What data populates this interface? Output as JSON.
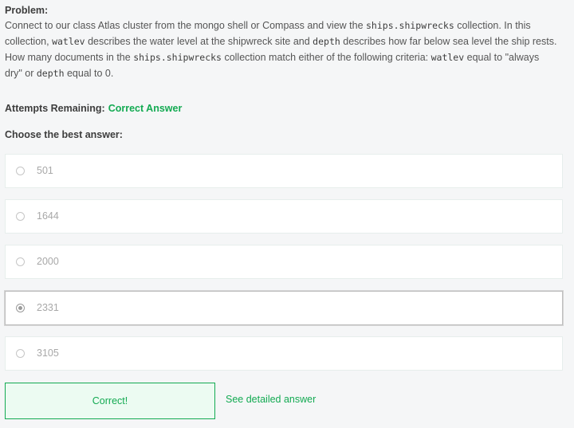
{
  "problem": {
    "title": "Problem:",
    "line1_a": "Connect to our class Atlas cluster from the mongo shell or Compass and view the ",
    "line1_code": "ships.shipwrecks",
    "line1_b": " collection. In this",
    "line2_a": "collection, ",
    "line2_code1": "watlev",
    "line2_b": " describes the water level at the shipwreck site and ",
    "line2_code2": "depth",
    "line2_c": " describes how far below sea level the ship rests.",
    "line3_a": "How many documents in the ",
    "line3_code1": "ships.shipwrecks",
    "line3_b": " collection match either of the following criteria: ",
    "line3_code2": "watlev",
    "line3_c": " equal to \"always",
    "line4_a": "dry\" or ",
    "line4_code": "depth",
    "line4_b": " equal to 0."
  },
  "attempts": {
    "label": "Attempts Remaining:",
    "status": "Correct Answer"
  },
  "choose_label": "Choose the best answer:",
  "options": [
    {
      "label": "501",
      "selected": false
    },
    {
      "label": "1644",
      "selected": false
    },
    {
      "label": "2000",
      "selected": false
    },
    {
      "label": "2331",
      "selected": true
    },
    {
      "label": "3105",
      "selected": false
    }
  ],
  "result": {
    "message": "Correct!",
    "detail_link": "See detailed answer"
  },
  "colors": {
    "accent": "#13aa52",
    "background": "#f5f6f7"
  }
}
